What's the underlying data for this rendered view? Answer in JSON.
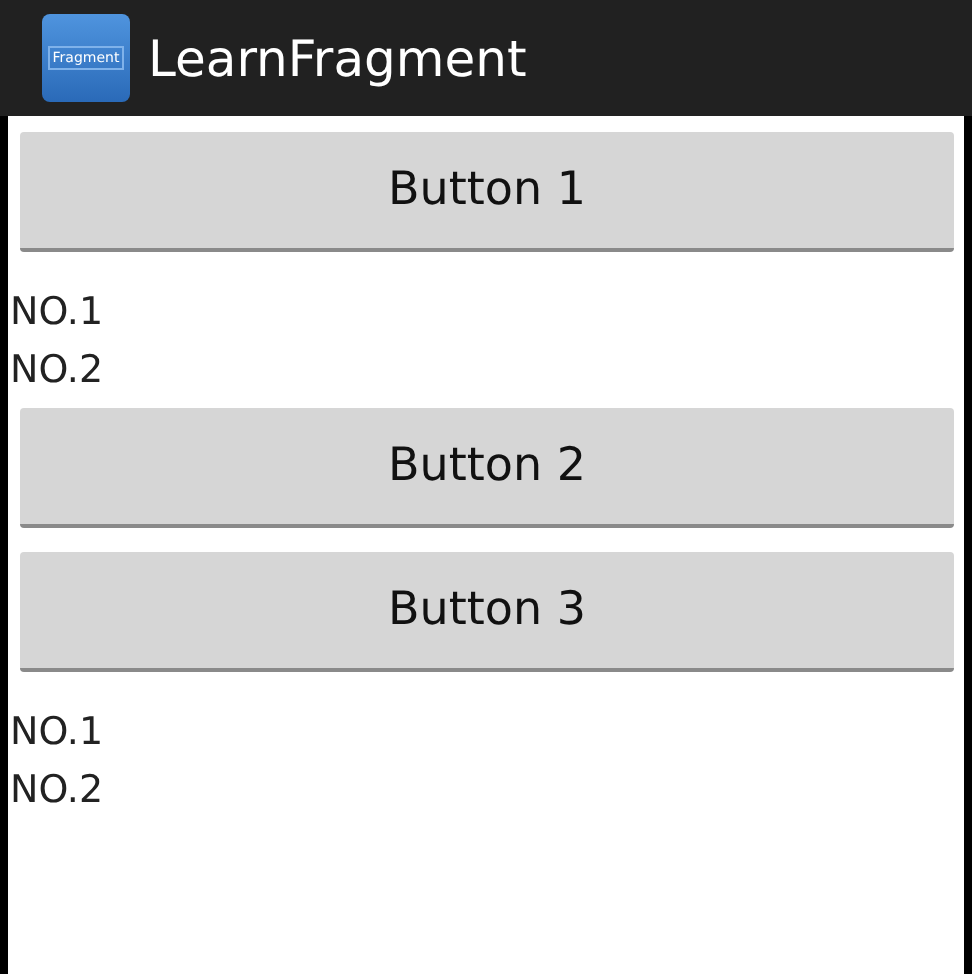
{
  "action_bar": {
    "icon_label": "Fragment",
    "title": "LearnFragment"
  },
  "content": [
    {
      "kind": "button",
      "text": "Button 1"
    },
    {
      "kind": "text",
      "text": "NO.1"
    },
    {
      "kind": "text",
      "text": "NO.2"
    },
    {
      "kind": "button",
      "text": "Button 2"
    },
    {
      "kind": "button",
      "text": "Button 3"
    },
    {
      "kind": "text",
      "text": "NO.1"
    },
    {
      "kind": "text",
      "text": "NO.2"
    }
  ]
}
